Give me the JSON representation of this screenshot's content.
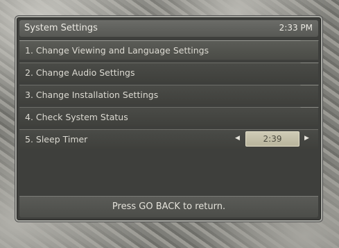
{
  "header": {
    "title": "System Settings",
    "time": "2:33 PM"
  },
  "menu": {
    "items": [
      {
        "label": "1.  Change Viewing and Language Settings"
      },
      {
        "label": "2.  Change Audio Settings"
      },
      {
        "label": "3.  Change Installation Settings"
      },
      {
        "label": "4.  Check System Status"
      },
      {
        "label": "5.  Sleep Timer"
      }
    ],
    "sleep_timer_value": "2:39"
  },
  "footer": {
    "text": "Press GO BACK to return."
  },
  "icons": {
    "left": "triangle-left-icon",
    "right": "triangle-right-icon"
  }
}
